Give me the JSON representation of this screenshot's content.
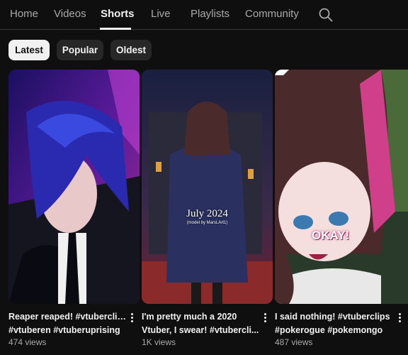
{
  "tabs": [
    {
      "label": "Home"
    },
    {
      "label": "Videos"
    },
    {
      "label": "Shorts"
    },
    {
      "label": "Live"
    },
    {
      "label": "Playlists"
    },
    {
      "label": "Community"
    }
  ],
  "active_tab": "Shorts",
  "search_icon": "search-icon",
  "chips": [
    {
      "label": "Latest",
      "selected": true
    },
    {
      "label": "Popular",
      "selected": false
    },
    {
      "label": "Oldest",
      "selected": false
    }
  ],
  "shorts": [
    {
      "title_line1": "Reaper reaped! #vtuberclips",
      "title_line2": "#vtuberen #vtuberuprising",
      "views": "474 views"
    },
    {
      "title_line1": "I'm pretty much a 2020",
      "title_line2": "Vtuber, I swear! #vtubercli...",
      "views": "1K views",
      "overlay_title": "July 2024",
      "overlay_sub": "(model by MarsLArt1)"
    },
    {
      "title_line1": "I said nothing! #vtuberclips",
      "title_line2": "#pokerogue #pokemongo",
      "views": "487 views",
      "overlay_text": "OKAY!"
    }
  ],
  "colors": {
    "background": "#0f0f0f",
    "chip_selected": "#f1f1f1",
    "chip_unselected": "#272727",
    "secondary_text": "#aaaaaa"
  }
}
